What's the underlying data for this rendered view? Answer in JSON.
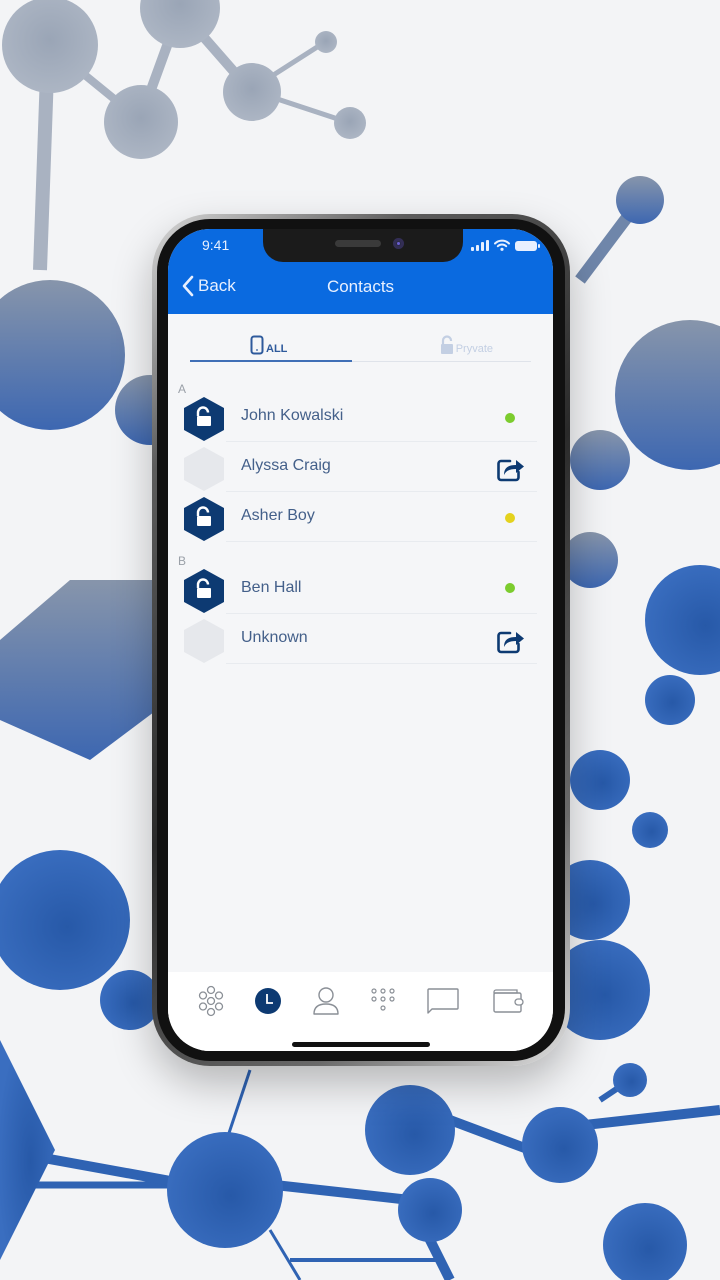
{
  "status_bar": {
    "time": "9:41"
  },
  "nav": {
    "back_label": "Back",
    "title": "Contacts"
  },
  "tabs": [
    {
      "label": "ALL",
      "icon": "phone-icon",
      "active": true
    },
    {
      "label": "Pryvate",
      "icon": "padlock-icon",
      "active": false
    }
  ],
  "sections": [
    {
      "letter": "A",
      "contacts": [
        {
          "name": "John Kowalski",
          "avatar": "lock-hexagon",
          "status": "online",
          "status_color": "#7ccc2e"
        },
        {
          "name": "Alyssa Craig",
          "avatar": "empty-hexagon",
          "action": "share-icon"
        },
        {
          "name": "Asher Boy",
          "avatar": "lock-hexagon",
          "status": "away",
          "status_color": "#e4d21e"
        }
      ]
    },
    {
      "letter": "B",
      "contacts": [
        {
          "name": "Ben Hall",
          "avatar": "lock-hexagon",
          "status": "online",
          "status_color": "#7ccc2e"
        },
        {
          "name": "Unknown",
          "avatar": "empty-hexagon",
          "action": "share-icon"
        }
      ]
    }
  ],
  "tab_bar": {
    "items": [
      {
        "icon": "flower-network-icon",
        "active": false
      },
      {
        "icon": "clock-icon",
        "active": true
      },
      {
        "icon": "person-icon",
        "active": false
      },
      {
        "icon": "dialpad-icon",
        "active": false
      },
      {
        "icon": "chat-bubble-icon",
        "active": false
      },
      {
        "icon": "wallet-icon",
        "active": false
      }
    ]
  },
  "colors": {
    "header_blue": "#0a6ae0",
    "navy": "#0d3a72",
    "text": "#44608a"
  }
}
